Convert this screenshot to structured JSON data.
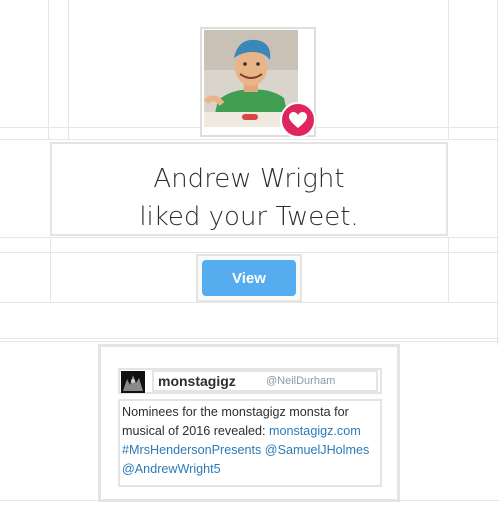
{
  "notification": {
    "user_name": "Andrew Wright",
    "action_text": "liked your Tweet.",
    "badge_icon": "heart-icon",
    "badge_color": "#e0245e"
  },
  "view_button": {
    "label": "View",
    "color": "#55acee"
  },
  "tweet": {
    "author_name": "monstagigz",
    "author_handle": "@NeilDurham",
    "text_line1": "Nominees for the monstagigz monsta for",
    "text_line2_plain": "musical of 2016 revealed: ",
    "text_line2_link": "monstagigz.com",
    "text_line3": "#MrsHendersonPresents @SamuelJHolmes",
    "text_line4": "@AndrewWright5",
    "link_color": "#2b7bb9"
  }
}
